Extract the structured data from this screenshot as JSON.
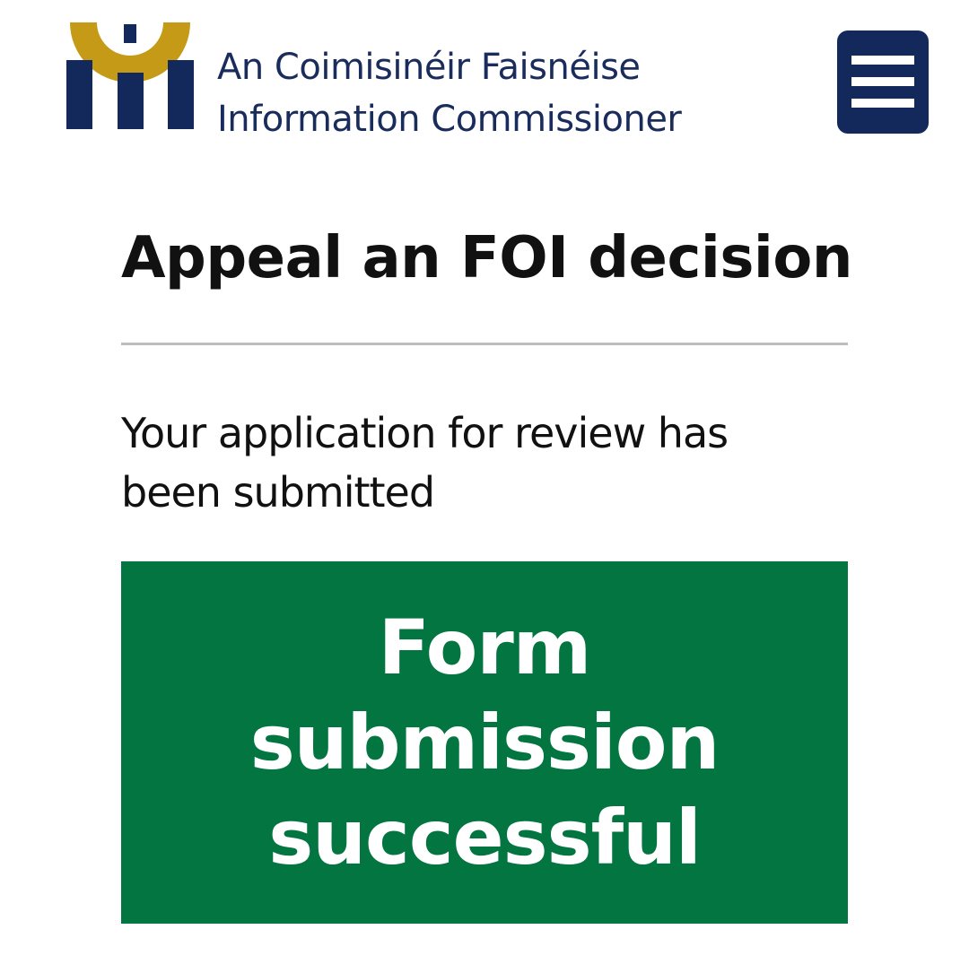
{
  "header": {
    "logo": {
      "icon_name": "information-commissioner-logo-icon",
      "line1": "An Coimisinéir Faisnéise",
      "line2": "Information Commissioner",
      "colors": {
        "navy": "#13295b",
        "gold": "#c49a17"
      }
    },
    "menu": {
      "icon_name": "hamburger-menu-icon",
      "background": "#13295b"
    }
  },
  "main": {
    "title": "Appeal an FOI decision",
    "message": "Your application for review has been submitted",
    "success_panel": {
      "text": "Form submission successful",
      "background": "#037541"
    }
  }
}
